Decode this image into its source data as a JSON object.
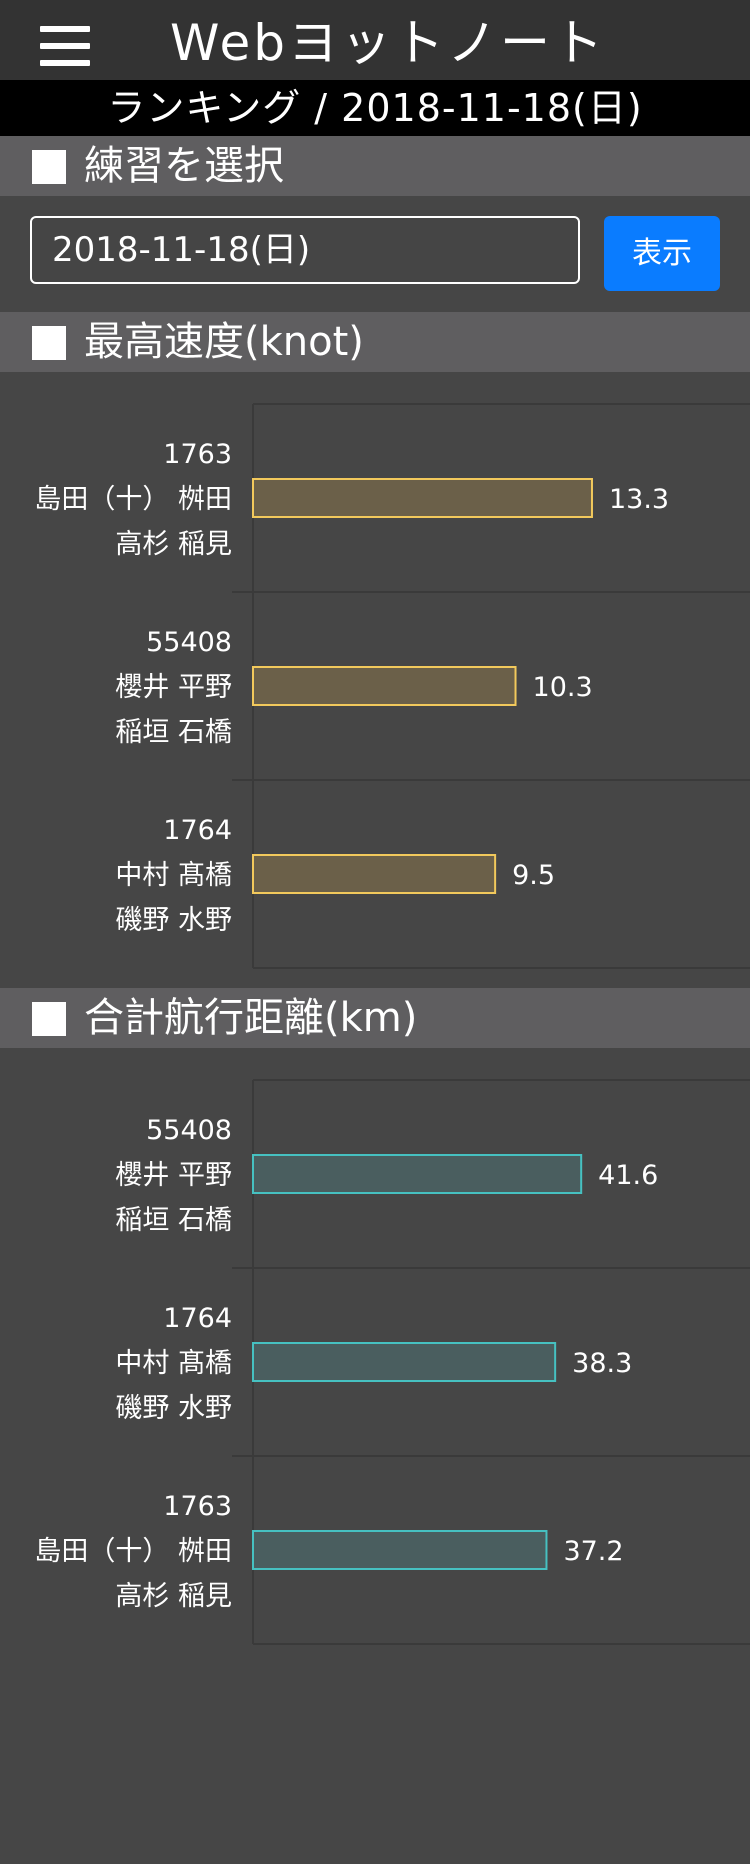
{
  "header": {
    "menu_icon": "hamburger-menu-icon",
    "title": "Webヨットノート"
  },
  "subtitle": "ランキング / 2018-11-18(日)",
  "practice_select": {
    "heading": "練習を選択",
    "date_value": "2018-11-18(日)",
    "show_button": "表示"
  },
  "colors": {
    "speed_bar_fill": "#6b6049",
    "speed_bar_stroke": "#f2c95c",
    "distance_bar_fill": "#4a5e5f",
    "distance_bar_stroke": "#46c1c1",
    "accent_button": "#0a7cff"
  },
  "chart_data": [
    {
      "type": "bar",
      "orientation": "horizontal",
      "title": "最高速度(knot)",
      "categories": [
        [
          "1763",
          "島田（十） 桝田",
          "高杉 稲見"
        ],
        [
          "55408",
          "櫻井 平野",
          "稲垣 石橋"
        ],
        [
          "1764",
          "中村 髙橋",
          "磯野 水野"
        ]
      ],
      "values": [
        13.3,
        10.3,
        9.5
      ],
      "data_labels": [
        "13.3",
        "10.3",
        "9.5"
      ],
      "xlim": [
        0,
        19.5
      ],
      "grid": true
    },
    {
      "type": "bar",
      "orientation": "horizontal",
      "title": "合計航行距離(km)",
      "categories": [
        [
          "55408",
          "櫻井 平野",
          "稲垣 石橋"
        ],
        [
          "1764",
          "中村 髙橋",
          "磯野 水野"
        ],
        [
          "1763",
          "島田（十） 桝田",
          "高杉 稲見"
        ]
      ],
      "values": [
        41.6,
        38.3,
        37.2
      ],
      "data_labels": [
        "41.6",
        "38.3",
        "37.2"
      ],
      "xlim": [
        0,
        63
      ],
      "grid": true
    }
  ]
}
